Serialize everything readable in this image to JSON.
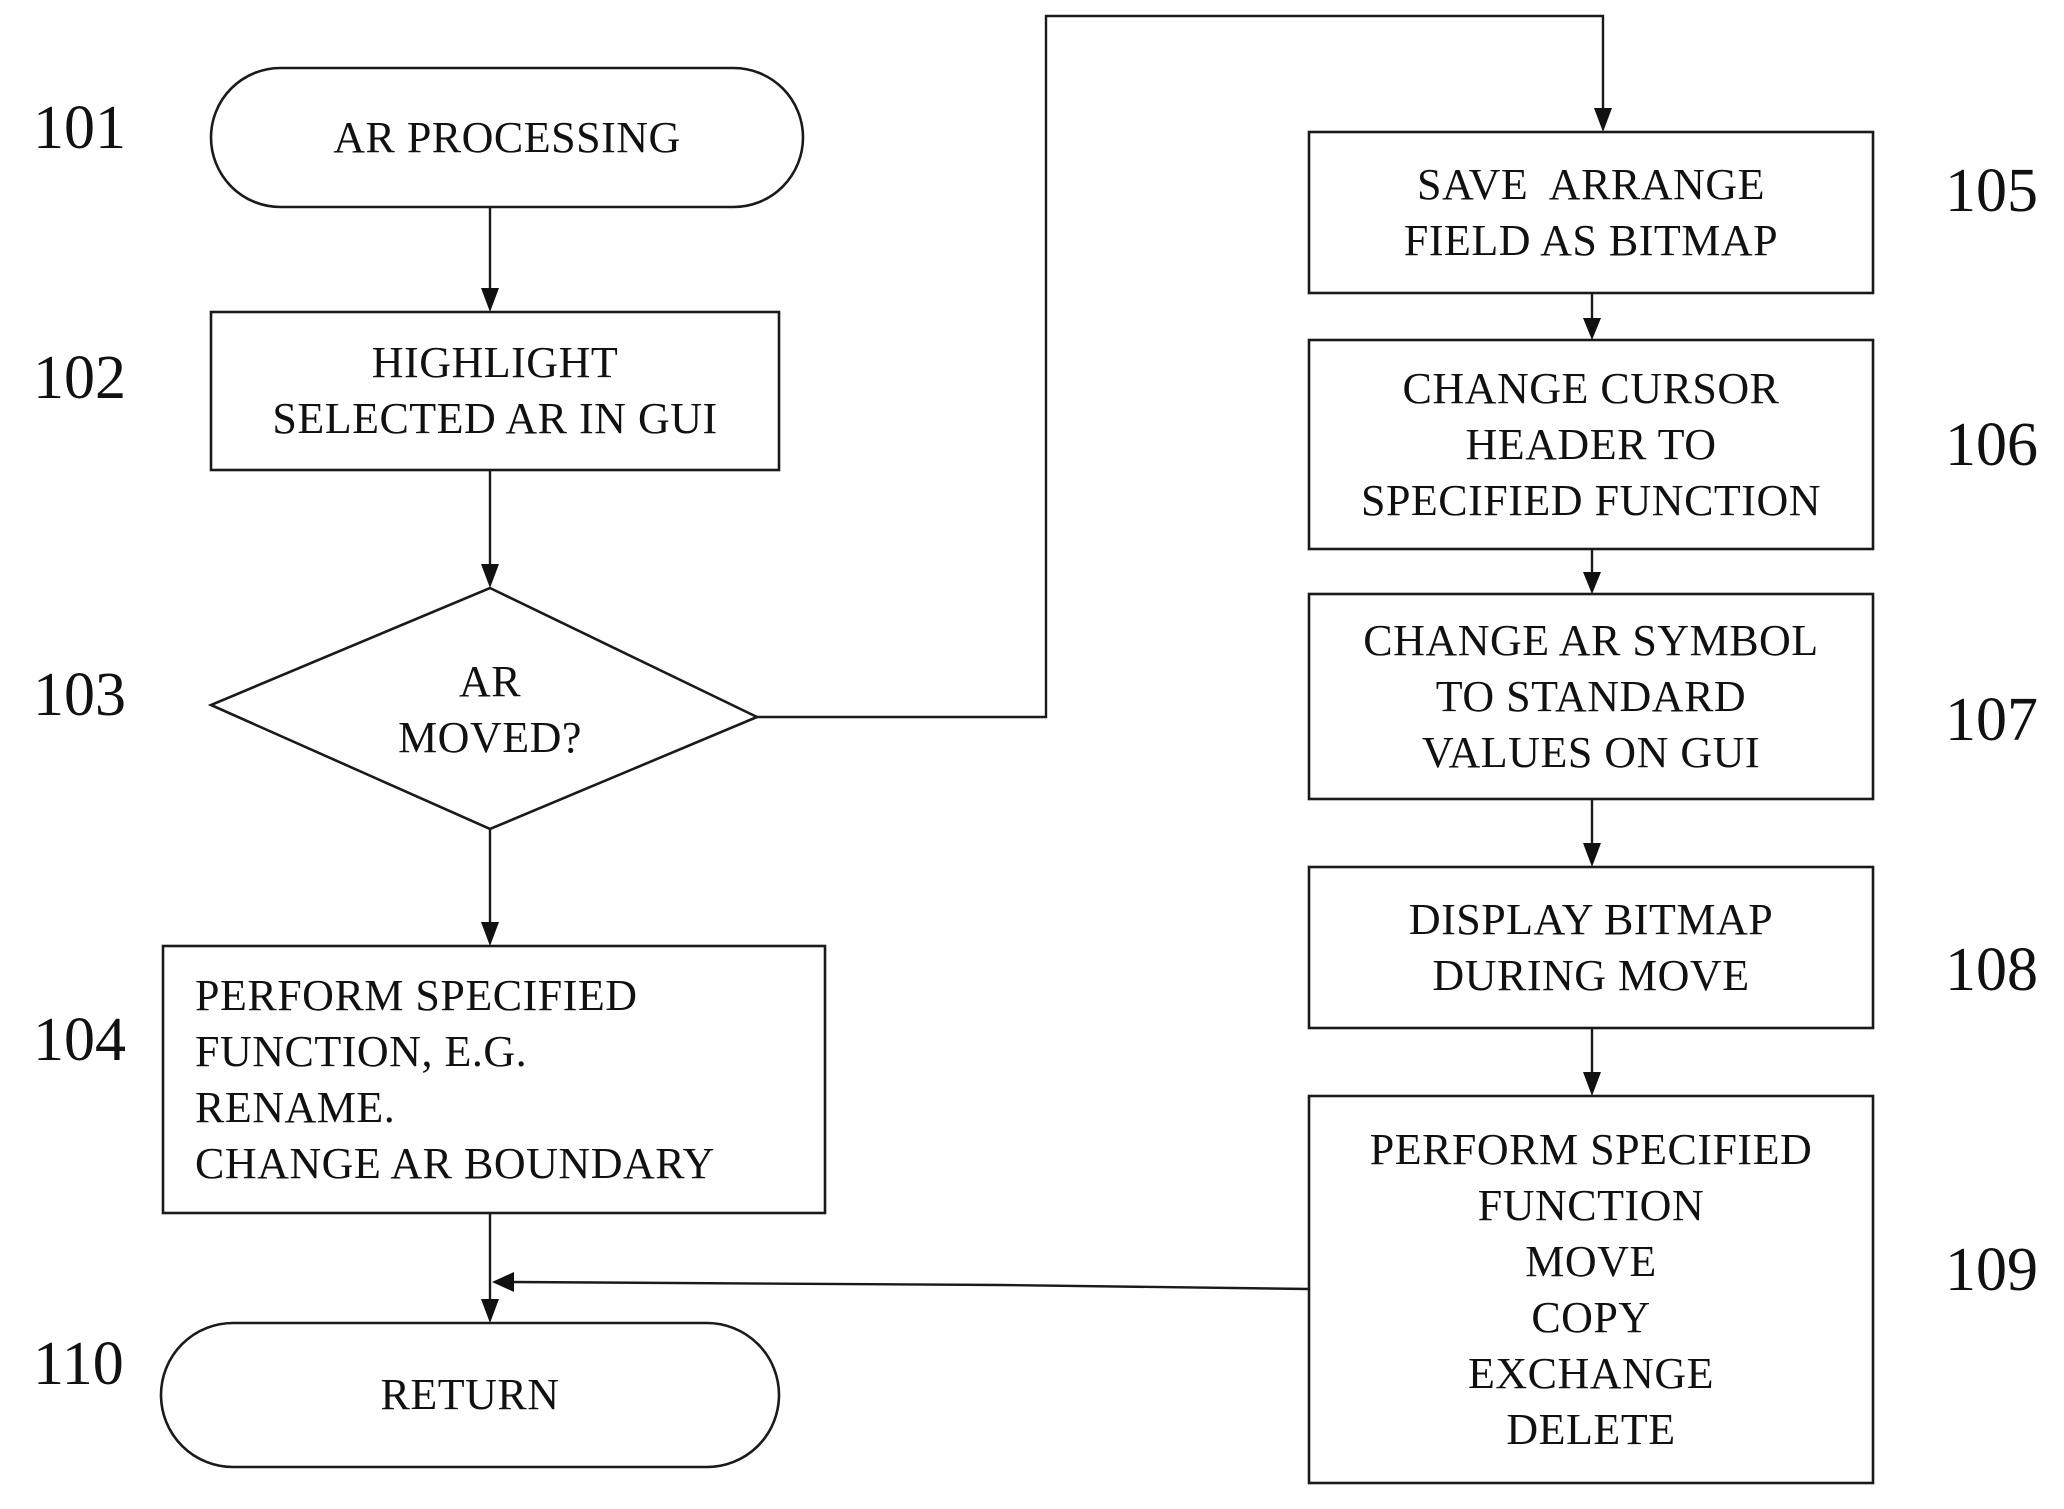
{
  "nodes": {
    "n101": {
      "ref": "101",
      "type": "terminator",
      "lines": [
        "AR PROCESSING"
      ]
    },
    "n102": {
      "ref": "102",
      "type": "process",
      "lines": [
        "HIGHLIGHT",
        "SELECTED AR IN GUI"
      ]
    },
    "n103": {
      "ref": "103",
      "type": "decision",
      "lines": [
        "AR",
        "MOVED?"
      ]
    },
    "n104": {
      "ref": "104",
      "type": "process",
      "lines": [
        "PERFORM SPECIFIED",
        "FUNCTION, E.G.",
        "RENAME.",
        "CHANGE AR BOUNDARY"
      ]
    },
    "n105": {
      "ref": "105",
      "type": "process",
      "lines": [
        "SAVE  ARRANGE",
        "FIELD AS BITMAP"
      ]
    },
    "n106": {
      "ref": "106",
      "type": "process",
      "lines": [
        "CHANGE CURSOR",
        "HEADER TO",
        "SPECIFIED FUNCTION"
      ]
    },
    "n107": {
      "ref": "107",
      "type": "process",
      "lines": [
        "CHANGE AR SYMBOL",
        "TO STANDARD",
        "VALUES ON GUI"
      ]
    },
    "n108": {
      "ref": "108",
      "type": "process",
      "lines": [
        "DISPLAY BITMAP",
        "DURING MOVE"
      ]
    },
    "n109": {
      "ref": "109",
      "type": "process",
      "lines": [
        "PERFORM SPECIFIED",
        "FUNCTION",
        "MOVE",
        "COPY",
        "EXCHANGE",
        "DELETE"
      ]
    },
    "n110": {
      "ref": "110",
      "type": "terminator",
      "lines": [
        "RETURN"
      ]
    }
  },
  "edges": [
    {
      "from": "101",
      "to": "102"
    },
    {
      "from": "102",
      "to": "103"
    },
    {
      "from": "103",
      "to": "104"
    },
    {
      "from": "103",
      "to": "105"
    },
    {
      "from": "105",
      "to": "106"
    },
    {
      "from": "106",
      "to": "107"
    },
    {
      "from": "107",
      "to": "108"
    },
    {
      "from": "108",
      "to": "109"
    },
    {
      "from": "104",
      "to": "110"
    },
    {
      "from": "109",
      "to": "110"
    }
  ]
}
